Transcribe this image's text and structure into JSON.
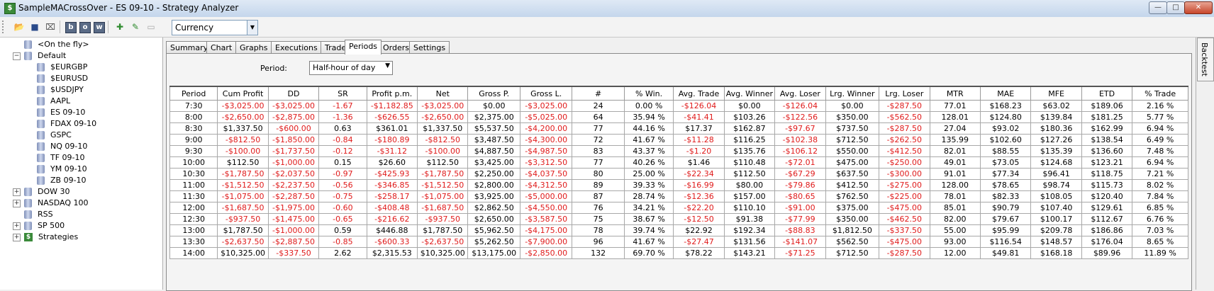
{
  "window": {
    "title": "SampleMACrossOver - ES 09-10 - Strategy Analyzer",
    "min": "—",
    "max": "□",
    "close": "✕"
  },
  "toolbar": {
    "display_value": "Currency"
  },
  "tree": [
    {
      "label": "<On the fly>",
      "level": 1,
      "icon": "db",
      "expander": ""
    },
    {
      "label": "Default",
      "level": 0,
      "icon": "db",
      "expander": "−"
    },
    {
      "label": "$EURGBP",
      "level": 2,
      "icon": "db",
      "expander": ""
    },
    {
      "label": "$EURUSD",
      "level": 2,
      "icon": "db",
      "expander": ""
    },
    {
      "label": "$USDJPY",
      "level": 2,
      "icon": "db",
      "expander": ""
    },
    {
      "label": "AAPL",
      "level": 2,
      "icon": "db",
      "expander": ""
    },
    {
      "label": "ES 09-10",
      "level": 2,
      "icon": "db",
      "expander": ""
    },
    {
      "label": "FDAX 09-10",
      "level": 2,
      "icon": "db",
      "expander": ""
    },
    {
      "label": "GSPC",
      "level": 2,
      "icon": "db",
      "expander": ""
    },
    {
      "label": "NQ 09-10",
      "level": 2,
      "icon": "db",
      "expander": ""
    },
    {
      "label": "TF 09-10",
      "level": 2,
      "icon": "db",
      "expander": ""
    },
    {
      "label": "YM 09-10",
      "level": 2,
      "icon": "db",
      "expander": ""
    },
    {
      "label": "ZB 09-10",
      "level": 2,
      "icon": "db",
      "expander": ""
    },
    {
      "label": "DOW 30",
      "level": 0,
      "icon": "db",
      "expander": "+"
    },
    {
      "label": "NASDAQ 100",
      "level": 0,
      "icon": "db",
      "expander": "+"
    },
    {
      "label": "RSS",
      "level": 1,
      "icon": "db",
      "expander": ""
    },
    {
      "label": "SP 500",
      "level": 0,
      "icon": "db",
      "expander": "+"
    },
    {
      "label": "Strategies",
      "level": 0,
      "icon": "dollar",
      "expander": "+"
    }
  ],
  "tabs": [
    "Summary",
    "Chart",
    "Graphs",
    "Executions",
    "Trades",
    "Periods",
    "Orders",
    "Settings"
  ],
  "active_tab": "Periods",
  "period": {
    "label": "Period:",
    "value": "Half-hour of day"
  },
  "side_tab": "Backtest",
  "table": {
    "columns": [
      "Period",
      "Cum Profit",
      "DD",
      "SR",
      "Profit p.m.",
      "Net",
      "Gross P.",
      "Gross L.",
      "#",
      "% Win.",
      "Avg. Trade",
      "Avg. Winner",
      "Avg. Loser",
      "Lrg. Winner",
      "Lrg. Loser",
      "MTR",
      "MAE",
      "MFE",
      "ETD",
      "% Trade"
    ],
    "rows": [
      [
        "7:30",
        "-$3,025.00",
        "-$3,025.00",
        "-1.67",
        "-$1,182.85",
        "-$3,025.00",
        "$0.00",
        "-$3,025.00",
        "24",
        "0.00 %",
        "-$126.04",
        "$0.00",
        "-$126.04",
        "$0.00",
        "-$287.50",
        "77.01",
        "$168.23",
        "$63.02",
        "$189.06",
        "2.16 %"
      ],
      [
        "8:00",
        "-$2,650.00",
        "-$2,875.00",
        "-1.36",
        "-$626.55",
        "-$2,650.00",
        "$2,375.00",
        "-$5,025.00",
        "64",
        "35.94 %",
        "-$41.41",
        "$103.26",
        "-$122.56",
        "$350.00",
        "-$562.50",
        "128.01",
        "$124.80",
        "$139.84",
        "$181.25",
        "5.77 %"
      ],
      [
        "8:30",
        "$1,337.50",
        "-$600.00",
        "0.63",
        "$361.01",
        "$1,337.50",
        "$5,537.50",
        "-$4,200.00",
        "77",
        "44.16 %",
        "$17.37",
        "$162.87",
        "-$97.67",
        "$737.50",
        "-$287.50",
        "27.04",
        "$93.02",
        "$180.36",
        "$162.99",
        "6.94 %"
      ],
      [
        "9:00",
        "-$812.50",
        "-$1,850.00",
        "-0.84",
        "-$180.89",
        "-$812.50",
        "$3,487.50",
        "-$4,300.00",
        "72",
        "41.67 %",
        "-$11.28",
        "$116.25",
        "-$102.38",
        "$712.50",
        "-$262.50",
        "135.99",
        "$102.60",
        "$127.26",
        "$138.54",
        "6.49 %"
      ],
      [
        "9:30",
        "-$100.00",
        "-$1,737.50",
        "-0.12",
        "-$31.12",
        "-$100.00",
        "$4,887.50",
        "-$4,987.50",
        "83",
        "43.37 %",
        "-$1.20",
        "$135.76",
        "-$106.12",
        "$550.00",
        "-$412.50",
        "82.01",
        "$88.55",
        "$135.39",
        "$136.60",
        "7.48 %"
      ],
      [
        "10:00",
        "$112.50",
        "-$1,000.00",
        "0.15",
        "$26.60",
        "$112.50",
        "$3,425.00",
        "-$3,312.50",
        "77",
        "40.26 %",
        "$1.46",
        "$110.48",
        "-$72.01",
        "$475.00",
        "-$250.00",
        "49.01",
        "$73.05",
        "$124.68",
        "$123.21",
        "6.94 %"
      ],
      [
        "10:30",
        "-$1,787.50",
        "-$2,037.50",
        "-0.97",
        "-$425.93",
        "-$1,787.50",
        "$2,250.00",
        "-$4,037.50",
        "80",
        "25.00 %",
        "-$22.34",
        "$112.50",
        "-$67.29",
        "$637.50",
        "-$300.00",
        "91.01",
        "$77.34",
        "$96.41",
        "$118.75",
        "7.21 %"
      ],
      [
        "11:00",
        "-$1,512.50",
        "-$2,237.50",
        "-0.56",
        "-$346.85",
        "-$1,512.50",
        "$2,800.00",
        "-$4,312.50",
        "89",
        "39.33 %",
        "-$16.99",
        "$80.00",
        "-$79.86",
        "$412.50",
        "-$275.00",
        "128.00",
        "$78.65",
        "$98.74",
        "$115.73",
        "8.02 %"
      ],
      [
        "11:30",
        "-$1,075.00",
        "-$2,287.50",
        "-0.75",
        "-$258.17",
        "-$1,075.00",
        "$3,925.00",
        "-$5,000.00",
        "87",
        "28.74 %",
        "-$12.36",
        "$157.00",
        "-$80.65",
        "$762.50",
        "-$225.00",
        "78.01",
        "$82.33",
        "$108.05",
        "$120.40",
        "7.84 %"
      ],
      [
        "12:00",
        "-$1,687.50",
        "-$1,975.00",
        "-0.60",
        "-$408.48",
        "-$1,687.50",
        "$2,862.50",
        "-$4,550.00",
        "76",
        "34.21 %",
        "-$22.20",
        "$110.10",
        "-$91.00",
        "$375.00",
        "-$475.00",
        "85.01",
        "$90.79",
        "$107.40",
        "$129.61",
        "6.85 %"
      ],
      [
        "12:30",
        "-$937.50",
        "-$1,475.00",
        "-0.65",
        "-$216.62",
        "-$937.50",
        "$2,650.00",
        "-$3,587.50",
        "75",
        "38.67 %",
        "-$12.50",
        "$91.38",
        "-$77.99",
        "$350.00",
        "-$462.50",
        "82.00",
        "$79.67",
        "$100.17",
        "$112.67",
        "6.76 %"
      ],
      [
        "13:00",
        "$1,787.50",
        "-$1,000.00",
        "0.59",
        "$446.88",
        "$1,787.50",
        "$5,962.50",
        "-$4,175.00",
        "78",
        "39.74 %",
        "$22.92",
        "$192.34",
        "-$88.83",
        "$1,812.50",
        "-$337.50",
        "55.00",
        "$95.99",
        "$209.78",
        "$186.86",
        "7.03 %"
      ],
      [
        "13:30",
        "-$2,637.50",
        "-$2,887.50",
        "-0.85",
        "-$600.33",
        "-$2,637.50",
        "$5,262.50",
        "-$7,900.00",
        "96",
        "41.67 %",
        "-$27.47",
        "$131.56",
        "-$141.07",
        "$562.50",
        "-$475.00",
        "93.00",
        "$116.54",
        "$148.57",
        "$176.04",
        "8.65 %"
      ],
      [
        "14:00",
        "$10,325.00",
        "-$337.50",
        "2.62",
        "$2,315.53",
        "$10,325.00",
        "$13,175.00",
        "-$2,850.00",
        "132",
        "69.70 %",
        "$78.22",
        "$143.21",
        "-$71.25",
        "$712.50",
        "-$287.50",
        "12.00",
        "$49.81",
        "$168.18",
        "$89.96",
        "11.89 %"
      ]
    ]
  },
  "colors": {
    "negative": "#e01b1b",
    "positive": "#000000"
  },
  "icons": [
    "open-folder-icon",
    "save-icon",
    "properties-icon",
    "b-icon",
    "o-icon",
    "w-icon",
    "add-icon",
    "edit-icon",
    "remove-icon"
  ]
}
